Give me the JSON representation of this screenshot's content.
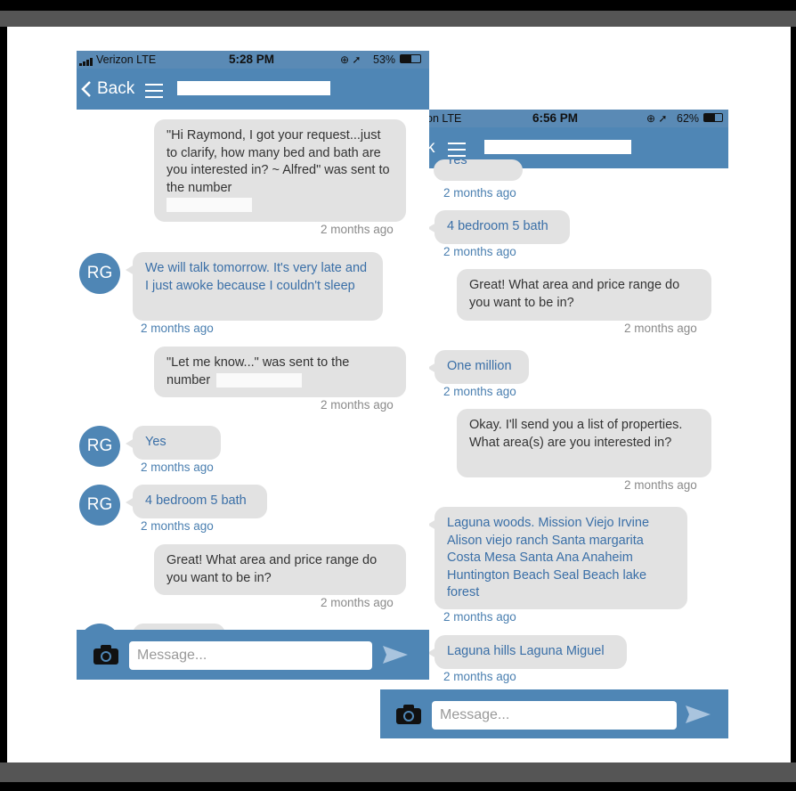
{
  "phone1": {
    "status": {
      "carrier": "Verizon  LTE",
      "time": "5:28 PM",
      "battery": "53%"
    },
    "nav": {
      "back_label": "Back"
    },
    "messages": [
      {
        "dir": "out",
        "text": "\"Hi Raymond, I got your request...just to clarify, how many bed and bath are you interested in? ~ Alfred\" was sent to the number",
        "time": "2 months ago"
      },
      {
        "dir": "in",
        "avatar": "RG",
        "text": "We will talk tomorrow. It's very late and I just awoke because I couldn't sleep",
        "time": "2 months ago"
      },
      {
        "dir": "out",
        "text": "\"Let me know...\" was sent to the number",
        "time": "2 months ago"
      },
      {
        "dir": "in",
        "avatar": "RG",
        "text": "Yes",
        "time": "2 months ago"
      },
      {
        "dir": "in",
        "avatar": "RG",
        "text": "4 bedroom 5 bath",
        "time": "2 months ago"
      },
      {
        "dir": "out",
        "text": "Great! What area and price range do you want to be in?",
        "time": "2 months ago"
      }
    ],
    "composer": {
      "placeholder": "Message..."
    }
  },
  "phone2": {
    "status": {
      "carrier": "on  LTE",
      "time": "6:56 PM",
      "battery": "62%"
    },
    "nav": {
      "back_label": "k"
    },
    "messages": [
      {
        "dir": "in",
        "text": "Yes",
        "time": "2 months ago"
      },
      {
        "dir": "in",
        "text": "4 bedroom 5 bath",
        "time": "2 months ago"
      },
      {
        "dir": "out",
        "text": "Great! What area and price range do you want to be in?",
        "time": "2 months ago"
      },
      {
        "dir": "in",
        "text": "One million",
        "time": "2 months ago"
      },
      {
        "dir": "out",
        "text": "Okay. I'll send you a list of properties. What area(s) are you interested in?",
        "time": "2 months ago"
      },
      {
        "dir": "in",
        "text": "Laguna woods. Mission Viejo Irvine Alison viejo ranch Santa margarita Costa Mesa Santa Ana Anaheim Huntington Beach Seal Beach lake forest",
        "time": "2 months ago"
      },
      {
        "dir": "in",
        "text": "Laguna hills Laguna Miguel",
        "time": "2 months ago"
      }
    ],
    "composer": {
      "placeholder": "Message..."
    }
  },
  "colors": {
    "accent": "#4f86b5",
    "bubble": "#e2e2e2",
    "incoming_text": "#3a6fa7"
  },
  "icons": [
    "chevron-left-icon",
    "hamburger-menu-icon",
    "camera-icon",
    "send-icon",
    "signal-icon",
    "battery-icon",
    "location-icon"
  ]
}
